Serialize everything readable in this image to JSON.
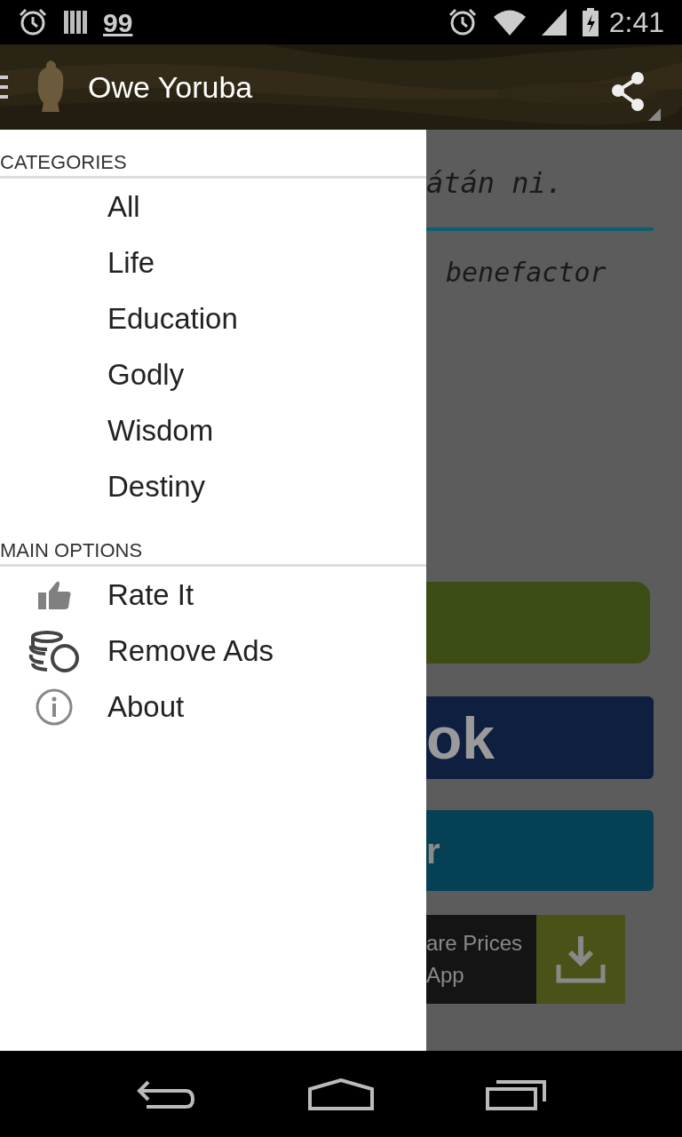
{
  "status_bar": {
    "notification": "99",
    "time": "2:41"
  },
  "app_bar": {
    "title": "Owe Yoruba"
  },
  "drawer": {
    "sections": [
      {
        "header": "CATEGORIES",
        "items": [
          {
            "label": "All"
          },
          {
            "label": "Life"
          },
          {
            "label": "Education"
          },
          {
            "label": "Godly"
          },
          {
            "label": "Wisdom"
          },
          {
            "label": "Destiny"
          }
        ]
      },
      {
        "header": "MAIN OPTIONS",
        "items": [
          {
            "label": "Rate It"
          },
          {
            "label": "Remove Ads"
          },
          {
            "label": "About"
          }
        ]
      }
    ]
  },
  "content": {
    "proverb": "átán ni.",
    "translation": "benefactor",
    "button_2_text": "ok",
    "button_3_text": "r",
    "ad": {
      "line_1": "are Prices",
      "line_2": "App"
    }
  }
}
